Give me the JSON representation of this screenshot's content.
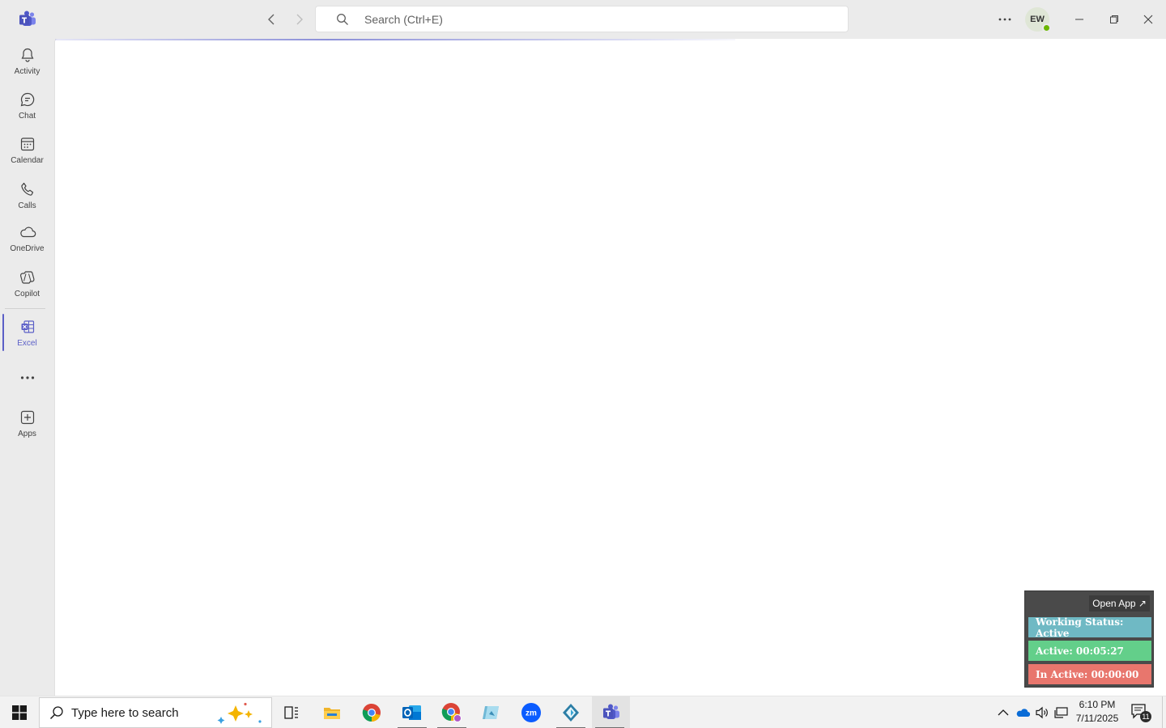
{
  "app": {
    "name": "Microsoft Teams",
    "search_placeholder": "Search (Ctrl+E)",
    "avatar_initials": "EW",
    "presence": "available"
  },
  "sidebar": {
    "items": [
      {
        "label": "Activity",
        "icon": "bell-icon"
      },
      {
        "label": "Chat",
        "icon": "chat-icon"
      },
      {
        "label": "Calendar",
        "icon": "calendar-icon"
      },
      {
        "label": "Calls",
        "icon": "phone-icon"
      },
      {
        "label": "OneDrive",
        "icon": "cloud-icon"
      },
      {
        "label": "Copilot",
        "icon": "copilot-icon"
      },
      {
        "label": "Excel",
        "icon": "excel-icon",
        "active": true
      },
      {
        "label": "Apps",
        "icon": "add-apps-icon"
      }
    ]
  },
  "tracker": {
    "open_app": "Open App ↗",
    "status": "Working Status: Active",
    "active": "Active: 00:05:27",
    "inactive": "In Active: 00:00:00",
    "colors": {
      "status": "#6fb9c4",
      "active": "#63cf8a",
      "inactive": "#e8766d"
    }
  },
  "taskbar": {
    "search_text": "Type here to search",
    "apps": [
      "task-view",
      "file-explorer",
      "chrome",
      "outlook",
      "chrome-profile",
      "photos",
      "zoom",
      "app",
      "teams"
    ],
    "time": "6:10 PM",
    "date": "7/11/2025",
    "notification_count": "11"
  },
  "colors": {
    "accent": "#5b5fc7",
    "presence_green": "#6bb700"
  }
}
